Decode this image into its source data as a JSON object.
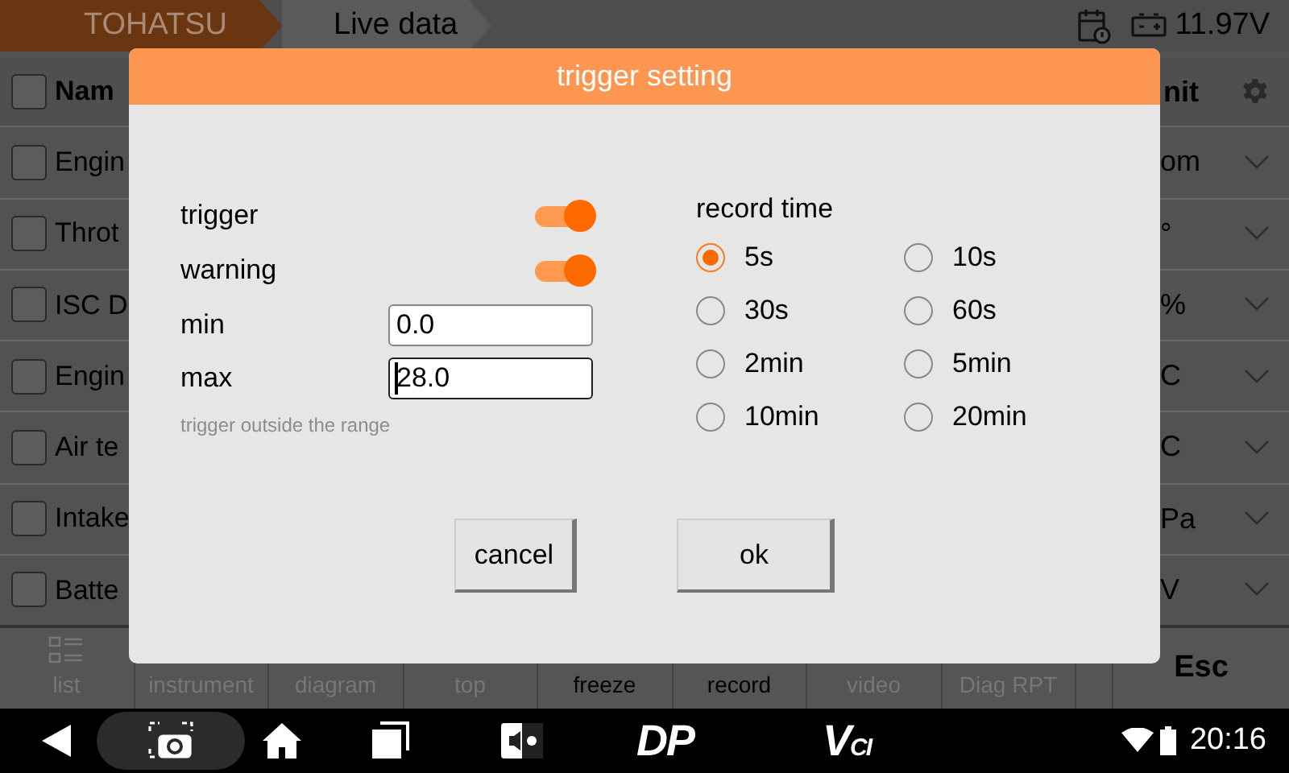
{
  "top_bar": {
    "breadcrumbs": [
      {
        "label": "TOHATSU",
        "selected": false
      },
      {
        "label": "Live data",
        "selected": true
      }
    ],
    "voltage": "11.97V"
  },
  "table": {
    "header": {
      "name": "Nam",
      "unit": "nit",
      "checked": false
    },
    "rows": [
      {
        "name": "Engin",
        "unit": "om",
        "checked": false
      },
      {
        "name": "Throt",
        "unit": "°",
        "checked": false
      },
      {
        "name": "ISC D",
        "unit": "%",
        "checked": false
      },
      {
        "name": "Engin",
        "unit": "C",
        "checked": false
      },
      {
        "name": "Air te",
        "unit": "C",
        "checked": false
      },
      {
        "name": "Intake",
        "unit": "Pa",
        "checked": false
      },
      {
        "name": "Batte",
        "unit": "V",
        "checked": false
      }
    ]
  },
  "toolbar": {
    "items": [
      {
        "label": "list",
        "disabled": true
      },
      {
        "label": "instrument",
        "disabled": true
      },
      {
        "label": "diagram",
        "disabled": true
      },
      {
        "label": "top",
        "disabled": true
      },
      {
        "label": "freeze",
        "disabled": false
      },
      {
        "label": "record",
        "disabled": false
      },
      {
        "label": "video",
        "disabled": true
      },
      {
        "label": "Diag RPT",
        "disabled": true
      }
    ],
    "esc": "Esc"
  },
  "dialog": {
    "title": "trigger setting",
    "switches": [
      {
        "label": "trigger",
        "on": true
      },
      {
        "label": "warning",
        "on": true
      }
    ],
    "fields": [
      {
        "label": "min",
        "value": "0.0",
        "focused": false
      },
      {
        "label": "max",
        "value": "28.0",
        "focused": true
      }
    ],
    "hint": "trigger outside the range",
    "record_time": {
      "label": "record time",
      "options": [
        {
          "label": "5s",
          "selected": true
        },
        {
          "label": "10s",
          "selected": false
        },
        {
          "label": "30s",
          "selected": false
        },
        {
          "label": "60s",
          "selected": false
        },
        {
          "label": "2min",
          "selected": false
        },
        {
          "label": "5min",
          "selected": false
        },
        {
          "label": "10min",
          "selected": false
        },
        {
          "label": "20min",
          "selected": false
        }
      ]
    },
    "buttons": [
      "cancel",
      "ok"
    ]
  },
  "nav_bar": {
    "logos": [
      {
        "main": "DP"
      },
      {
        "main": "V",
        "sub": "CI"
      }
    ],
    "time": "20:16"
  }
}
